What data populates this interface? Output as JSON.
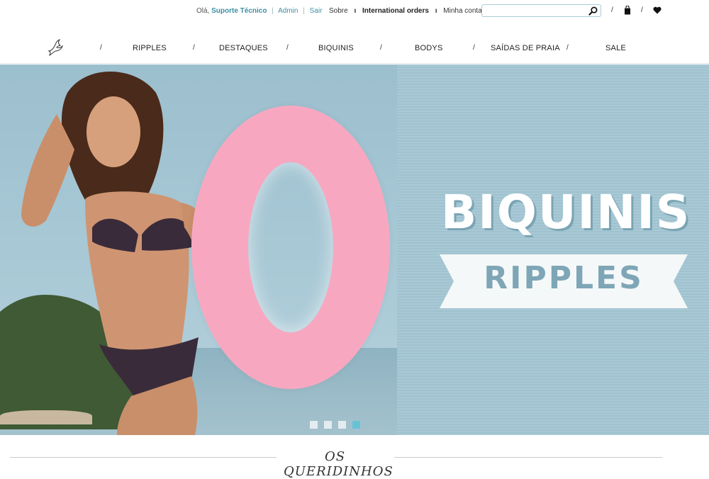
{
  "header": {
    "greeting_prefix": "Olá,",
    "user_name": "Suporte Técnico",
    "admin_link": "Admin",
    "logout_link": "Sair",
    "links": [
      "Sobre",
      "International orders",
      "Minha conta"
    ],
    "search_placeholder": ""
  },
  "nav": {
    "items": [
      "RIPPLES",
      "DESTAQUES",
      "BIQUINIS",
      "BODYS",
      "SAÍDAS DE PRAIA",
      "SALE"
    ]
  },
  "hero": {
    "headline": "BIQUINIS",
    "banner_text": "RIPPLES",
    "slides_count": 4,
    "active_slide": 4
  },
  "section": {
    "title": "OS QUERIDINHOS"
  },
  "colors": {
    "accent": "#3d8fa3",
    "hero_blue": "#a3c6d3",
    "ring_pink": "#f7a8c0",
    "active_dot": "#66c3d6"
  }
}
